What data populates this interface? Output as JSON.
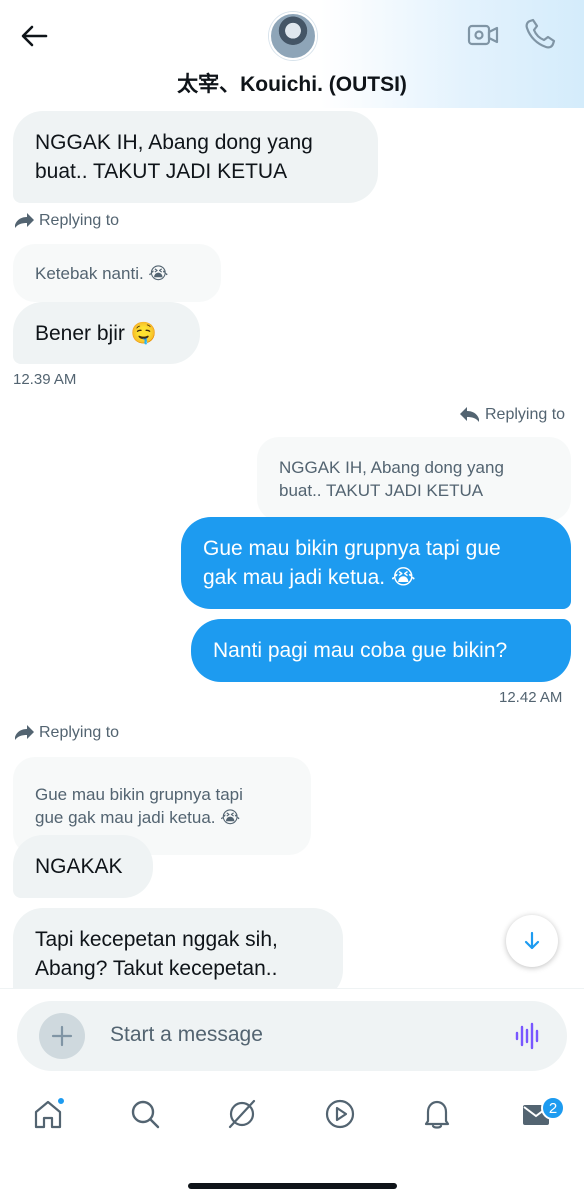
{
  "header": {
    "title": "太宰、Kouichi. (OUTSI)",
    "icons": [
      "back-arrow-icon",
      "video-camera-icon",
      "phone-icon"
    ]
  },
  "messages": {
    "m1": "NGGAK IH, Abang dong yang\nbuat.. TAKUT JADI KETUA",
    "reply_label_1": "Replying to",
    "quote_1": "Ketebak nanti. 😭",
    "m2": "Bener bjir 🤤",
    "time_1": "12.39 AM",
    "reply_label_2": "Replying to",
    "quote_2": "NGGAK IH, Abang dong yang\nbuat.. TAKUT JADI KETUA",
    "m3": "Gue mau bikin grupnya tapi gue\ngak mau jadi ketua. 😭",
    "m4": "Nanti pagi mau coba gue bikin?",
    "time_2": "12.42 AM",
    "reply_label_3": "Replying to",
    "quote_3": "Gue mau bikin grupnya tapi\ngue gak mau jadi ketua. 😭",
    "m5": "NGAKAK",
    "m6": "Tapi kecepetan nggak sih,\nAbang? Takut kecepetan.."
  },
  "composer": {
    "placeholder": "Start a message"
  },
  "tabbar": {
    "items": [
      "home-icon",
      "search-icon",
      "grok-icon",
      "video-icon",
      "notifications-icon",
      "messages-icon"
    ],
    "messages_badge": "2"
  },
  "colors": {
    "accent": "#1d9bf0",
    "incoming_bubble": "#eff3f4",
    "quote_bubble": "#f7f9f9",
    "secondary_text": "#536471"
  }
}
